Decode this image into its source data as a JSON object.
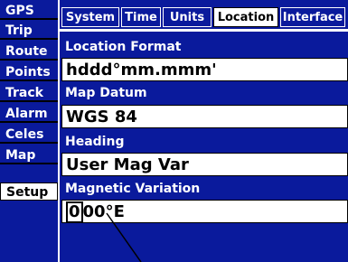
{
  "sidebar": {
    "items": [
      {
        "label": "GPS"
      },
      {
        "label": "Trip"
      },
      {
        "label": "Route"
      },
      {
        "label": "Points"
      },
      {
        "label": "Track"
      },
      {
        "label": "Alarm"
      },
      {
        "label": "Celes"
      },
      {
        "label": "Map"
      },
      {
        "label": "Setup",
        "selected": true
      }
    ]
  },
  "tabs": [
    {
      "label": "System"
    },
    {
      "label": "Time"
    },
    {
      "label": "Units"
    },
    {
      "label": "Location",
      "active": true
    },
    {
      "label": "Interface"
    }
  ],
  "fields": {
    "location_format": {
      "label": "Location Format",
      "value": "hddd°mm.mmm'"
    },
    "map_datum": {
      "label": "Map Datum",
      "value": "WGS 84"
    },
    "heading": {
      "label": "Heading",
      "value": "User Mag Var"
    },
    "magnetic_variation": {
      "label": "Magnetic Variation",
      "value_cursor": "0",
      "value_rest": "00°E"
    }
  },
  "colors": {
    "background_blue": "#0a1a9c",
    "text_white": "#ffffff",
    "field_white": "#ffffff",
    "text_black": "#000000"
  }
}
